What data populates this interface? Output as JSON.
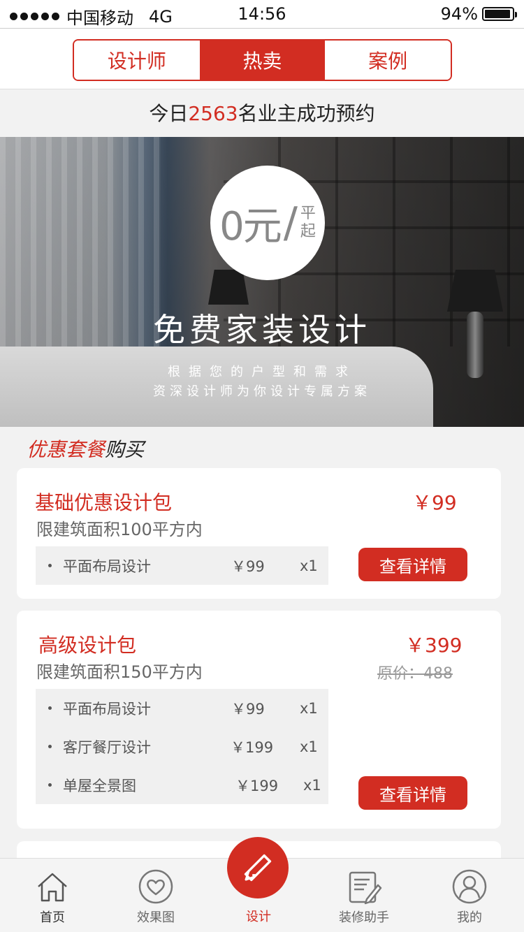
{
  "status_bar": {
    "carrier": "中国移动",
    "network": "4G",
    "time": "14:56",
    "battery": "94%",
    "battery_level": 0.94
  },
  "tabs": [
    {
      "label": "设计师",
      "active": false
    },
    {
      "label": "热卖",
      "active": true
    },
    {
      "label": "案例",
      "active": false
    }
  ],
  "booking": {
    "prefix": "今日",
    "count": "2563",
    "suffix": "名业主成功预约"
  },
  "hero": {
    "price": "0元",
    "slash": "/",
    "unit_top": "平",
    "unit_bottom": "起",
    "title": "免费家装设计",
    "subtitle_line1": "根据您的户型和需求",
    "subtitle_line2": "资深设计师为你设计专属方案"
  },
  "section": {
    "title_red": "优惠套餐",
    "title_black": "购买"
  },
  "packages": [
    {
      "name": "基础优惠设计包",
      "desc": "限建筑面积100平方内",
      "price": "￥99",
      "original_price": "",
      "items": [
        {
          "name": "平面布局设计",
          "price": "￥99",
          "qty": "x1"
        }
      ],
      "button": "查看详情"
    },
    {
      "name": "高级设计包",
      "desc": "限建筑面积150平方内",
      "price": "￥399",
      "original_price": "原价：488",
      "items": [
        {
          "name": "平面布局设计",
          "price": "￥99",
          "qty": "x1"
        },
        {
          "name": "客厅餐厅设计",
          "price": "￥199",
          "qty": "x1"
        },
        {
          "name": "单屋全景图",
          "price": "￥199",
          "qty": "x1"
        }
      ],
      "button": "查看详情"
    }
  ],
  "bottom_nav": [
    {
      "label": "首页",
      "icon": "home-icon"
    },
    {
      "label": "效果图",
      "icon": "heart-icon"
    },
    {
      "label": "设计",
      "icon": "design-tools-icon"
    },
    {
      "label": "装修助手",
      "icon": "notepad-icon"
    },
    {
      "label": "我的",
      "icon": "user-icon"
    }
  ],
  "colors": {
    "accent": "#d22d22",
    "background": "#f2f2f2"
  }
}
